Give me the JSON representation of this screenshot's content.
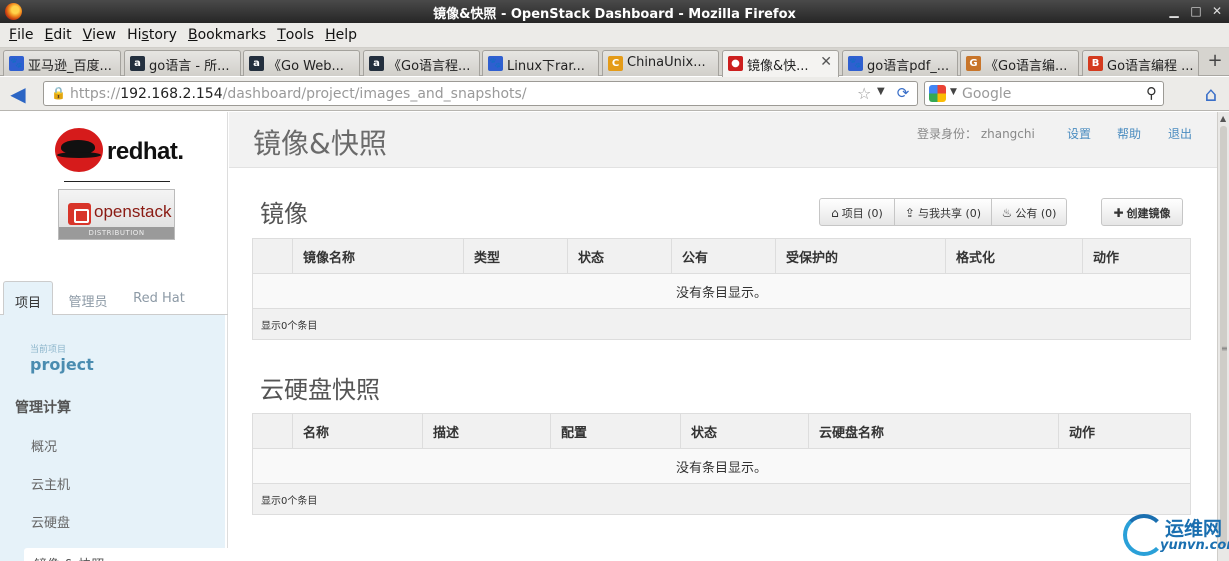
{
  "window": {
    "title": "镜像&快照 - OpenStack Dashboard - Mozilla Firefox"
  },
  "menu": [
    {
      "pre": "",
      "u": "F",
      "post": "ile"
    },
    {
      "pre": "",
      "u": "E",
      "post": "dit"
    },
    {
      "pre": "",
      "u": "V",
      "post": "iew"
    },
    {
      "pre": "Hi",
      "u": "s",
      "post": "tory"
    },
    {
      "pre": "",
      "u": "B",
      "post": "ookmarks"
    },
    {
      "pre": "",
      "u": "T",
      "post": "ools"
    },
    {
      "pre": "",
      "u": "H",
      "post": "elp"
    }
  ],
  "tabs": [
    {
      "label": "亚马逊_百度...",
      "icon": "baidu-paw-icon",
      "color": "#2f5fd0"
    },
    {
      "label": "go语言 - 所...",
      "icon": "amazon-a-icon",
      "color": "#232f3e"
    },
    {
      "label": "《Go Web...",
      "icon": "amazon-a-icon",
      "color": "#232f3e"
    },
    {
      "label": "《Go语言程...",
      "icon": "amazon-a-icon",
      "color": "#232f3e"
    },
    {
      "label": "Linux下rar...",
      "icon": "baidu-paw-icon",
      "color": "#2f5fd0"
    },
    {
      "label": "ChinaUnix...",
      "icon": "chinaunix-icon",
      "color": "#e49b18"
    },
    {
      "label": "镜像&快...",
      "icon": "redhat-icon",
      "color": "#cc1f1f",
      "active": true
    },
    {
      "label": "go语言pdf_...",
      "icon": "baidu-paw-icon",
      "color": "#2f5fd0"
    },
    {
      "label": "《Go语言编...",
      "icon": "douban-book-icon",
      "color": "#c8752a"
    },
    {
      "label": "Go语言编程 ...",
      "icon": "jd-b-icon",
      "color": "#d43a1e"
    }
  ],
  "nav": {
    "url_scheme": "https://",
    "url_host": "192.168.2.154",
    "url_path": "/dashboard/project/images_and_snapshots/",
    "search_placeholder": "Google"
  },
  "sidebar": {
    "brand": "redhat.",
    "product": "openstack",
    "product_sub": "DISTRIBUTION",
    "tabs": [
      "项目",
      "管理员",
      "Red Hat"
    ],
    "current_label": "当前项目",
    "current_project": "project",
    "section": "管理计算",
    "items": [
      "概况",
      "云主机",
      "云硬盘",
      "镜像 & 快照"
    ]
  },
  "header": {
    "title": "镜像&快照",
    "user_label": "登录身份： zhangchi",
    "links": [
      "设置",
      "帮助",
      "退出"
    ]
  },
  "images": {
    "title": "镜像",
    "filters": [
      {
        "icon": "home-icon",
        "label": "项目 (0)"
      },
      {
        "icon": "share-icon",
        "label": "与我共享 (0)"
      },
      {
        "icon": "fire-icon",
        "label": "公有 (0)"
      }
    ],
    "create_label": "创建镜像",
    "columns": [
      "",
      "镜像名称",
      "类型",
      "状态",
      "公有",
      "受保护的",
      "格式化",
      "动作"
    ],
    "empty_text": "没有条目显示。",
    "footer": "显示0个条目"
  },
  "snapshots": {
    "title": "云硬盘快照",
    "columns": [
      "",
      "名称",
      "描述",
      "配置",
      "状态",
      "云硬盘名称",
      "动作"
    ],
    "empty_text": "没有条目显示。",
    "footer": "显示0个条目"
  },
  "watermark": {
    "cn": "运维网",
    "en": "yunvn.com"
  }
}
